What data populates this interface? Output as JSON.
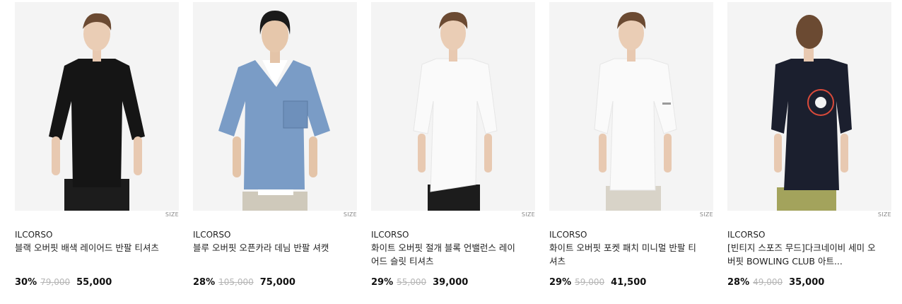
{
  "products": [
    {
      "brand": "ILCORSO",
      "name": "블랙 오버핏 배색 레이어드 반팔 티셔츠",
      "discount": "30%",
      "original_price": "79,000",
      "sale_price": "55,000",
      "size_label": "SIZE",
      "shirt_color": "#151515",
      "pants_color": "#1c1c1c"
    },
    {
      "brand": "ILCORSO",
      "name": "블루 오버핏 오픈카라 데님 반팔 셔캣",
      "discount": "28%",
      "original_price": "105,000",
      "sale_price": "75,000",
      "size_label": "SIZE",
      "shirt_color": "#7a9cc6",
      "pants_color": "#cfc9bb"
    },
    {
      "brand": "ILCORSO",
      "name": "화이트 오버핏 절개 블록 언밸런스 레이어드 슬릿 티셔츠",
      "discount": "29%",
      "original_price": "55,000",
      "sale_price": "39,000",
      "size_label": "SIZE",
      "shirt_color": "#f7f7f7",
      "pants_color": "#1c1c1c"
    },
    {
      "brand": "ILCORSO",
      "name": "화이트 오버핏 포켓 패치 미니멀 반팔 티셔츠",
      "discount": "29%",
      "original_price": "59,000",
      "sale_price": "41,500",
      "size_label": "SIZE",
      "shirt_color": "#f7f7f7",
      "pants_color": "#d8d3c8"
    },
    {
      "brand": "ILCORSO",
      "name": "[빈티지 스포즈 무드]다크네이비 세미 오버핏 BOWLING CLUB 아트...",
      "discount": "28%",
      "original_price": "49,000",
      "sale_price": "35,000",
      "size_label": "SIZE",
      "shirt_color": "#1b1f2e",
      "pants_color": "#a3a35c"
    }
  ]
}
